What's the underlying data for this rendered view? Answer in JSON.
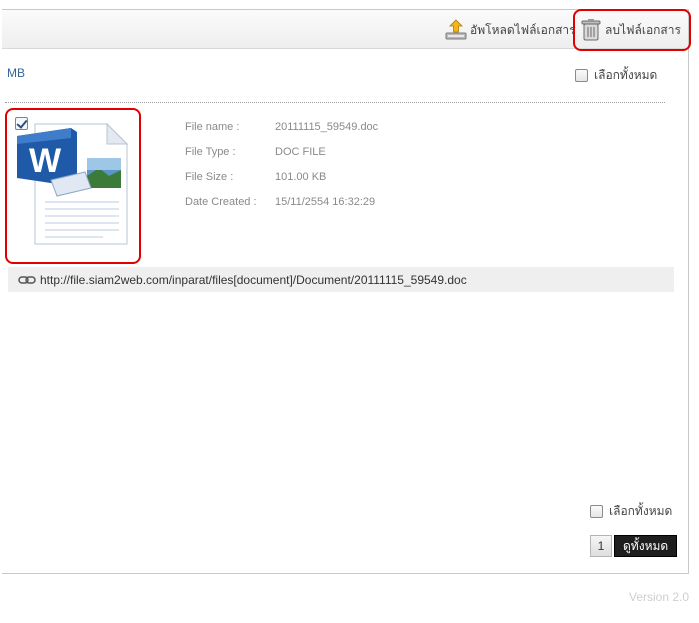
{
  "toolbar": {
    "upload_label": "อัพโหลดไฟล์เอกสาร",
    "delete_label": "ลบไฟล์เอกสาร",
    "upload_icon": "upload-icon",
    "delete_icon": "trash-icon"
  },
  "unit_label": "MB",
  "select_all_label": "เลือกทั้งหมด",
  "file": {
    "checked": true,
    "icon": "word-document-icon",
    "fields": [
      {
        "key": "File name :",
        "value": "20111115_59549.doc"
      },
      {
        "key": "File Type :",
        "value": "DOC FILE"
      },
      {
        "key": "File Size :",
        "value": "101.00 KB"
      },
      {
        "key": "Date Created :",
        "value": "15/11/2554 16:32:29"
      }
    ],
    "url": "http://file.siam2web.com/inparat/files[document]/Document/20111115_59549.doc"
  },
  "pagination": {
    "current_page": "1",
    "view_all_label": "ดูทั้งหมด"
  },
  "version": "Version 2.0",
  "colors": {
    "highlight": "#e00000",
    "unit_label": "#336699",
    "view_all_bg": "#1e1e1e"
  }
}
